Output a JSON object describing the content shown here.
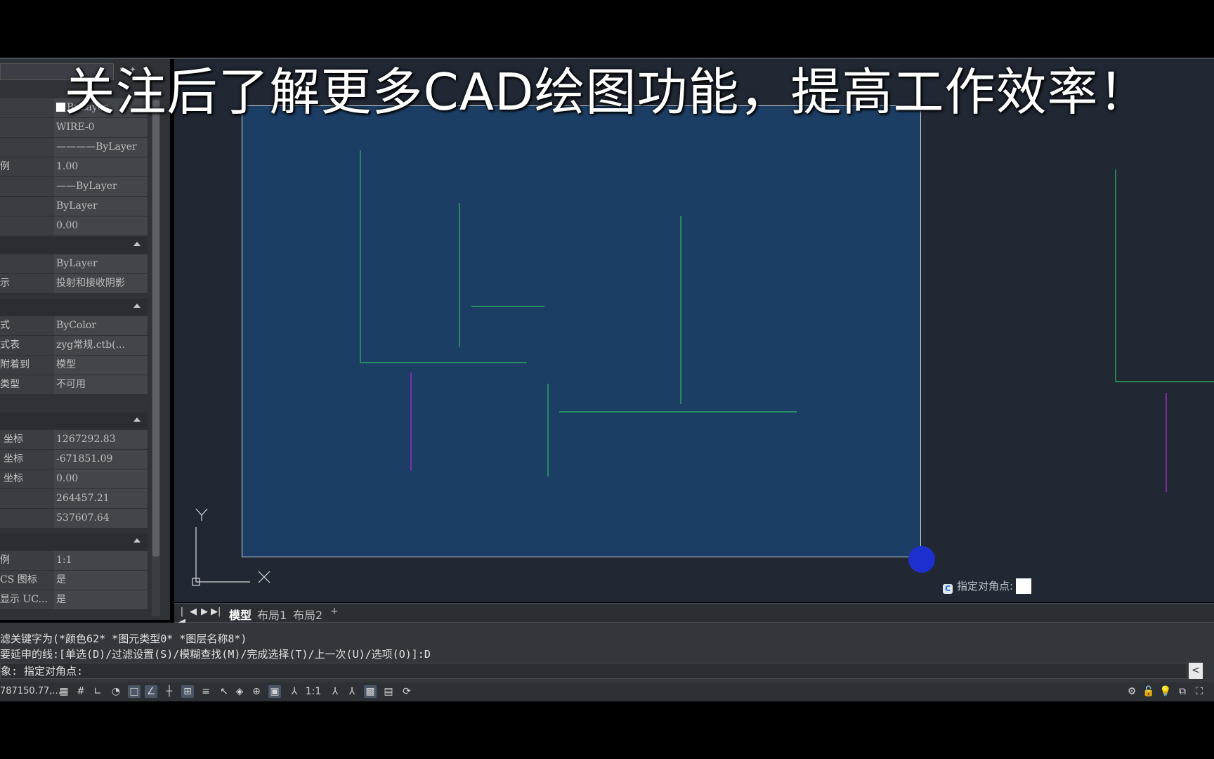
{
  "caption": "关注后了解更多CAD绘图功能，提高工作效率！",
  "properties": {
    "rows": [
      {
        "key": "",
        "value": "ByLayer",
        "swatch": true
      },
      {
        "key": "",
        "value": "WIRE-0"
      },
      {
        "key": "",
        "value": "————ByLayer"
      },
      {
        "key": "例",
        "value": "1.00"
      },
      {
        "key": "",
        "value": "——ByLayer"
      },
      {
        "key": "",
        "value": "ByLayer"
      },
      {
        "key": "",
        "value": "0.00"
      },
      {
        "key": "",
        "value": "ByLayer"
      },
      {
        "key": "示",
        "value": "投射和接收阴影"
      },
      {
        "key": "式",
        "value": "ByColor"
      },
      {
        "key": "式表",
        "value": "zyg常规.ctb(..."
      },
      {
        "key": "附着到",
        "value": "模型"
      },
      {
        "key": "类型",
        "value": "不可用"
      },
      {
        "key": "坐标",
        "value": "1267292.83"
      },
      {
        "key": "坐标",
        "value": "-671851.09"
      },
      {
        "key": "坐标",
        "value": "0.00"
      },
      {
        "key": "",
        "value": "264457.21"
      },
      {
        "key": "",
        "value": "537607.64"
      },
      {
        "key": "例",
        "value": "1:1"
      },
      {
        "key": "CS 图标",
        "value": "是"
      },
      {
        "key": "显示 UC...",
        "value": "是"
      }
    ]
  },
  "ucs": {
    "x_label": "X",
    "y_label": "Y"
  },
  "prompt": {
    "text": "指定对角点:",
    "icon": "c-app-icon"
  },
  "tabs": {
    "nav": [
      "|◀",
      "◀",
      "▶",
      "▶|"
    ],
    "items": [
      "模型",
      "布局1",
      "布局2"
    ],
    "active": "模型",
    "add": "+"
  },
  "command": {
    "lines": [
      "滤关键字为(*颜色62* *图元类型0* *图层名称8*)",
      "要延申的线:[单选(D)/过滤设置(S)/模糊查找(M)/完成选择(T)/上一次(U)/选项(O)]:D",
      "象: 指定对角点:"
    ],
    "scroll_btn": "<"
  },
  "status": {
    "coords": "787150.77,...",
    "scale": "1:1"
  },
  "colors": {
    "canvas": "#212834",
    "selection": "#1d3e64",
    "green_line": "#2bbd62",
    "magenta_line": "#9a2ab8",
    "grip": "#1e2fcf"
  }
}
